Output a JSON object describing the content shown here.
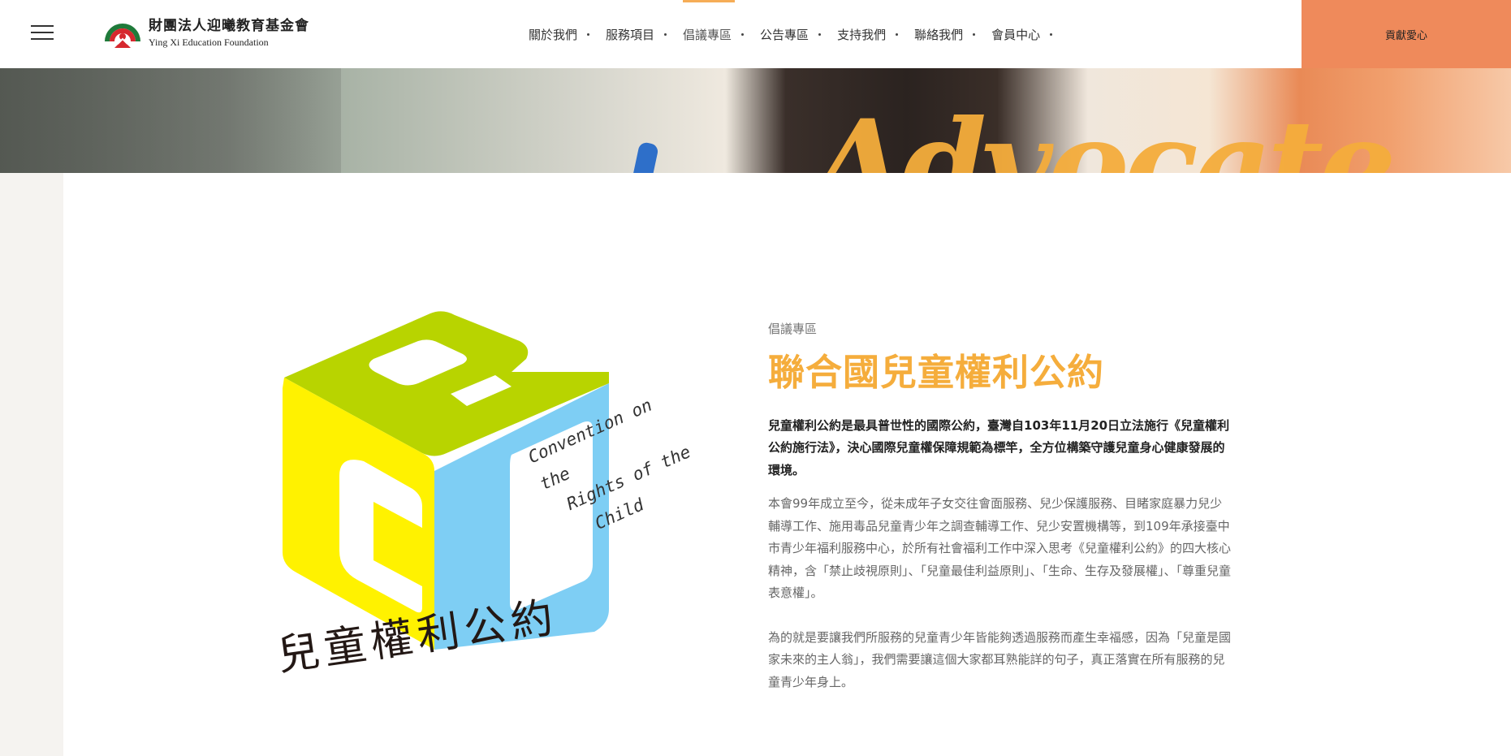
{
  "header": {
    "logo": {
      "name_cn": "財團法人迎曦教育基金會",
      "name_en": "Ying Xi Education Foundation"
    },
    "nav": [
      {
        "label": "關於我們"
      },
      {
        "label": "服務項目"
      },
      {
        "label": "倡議專區",
        "active": true
      },
      {
        "label": "公告專區"
      },
      {
        "label": "支持我們"
      },
      {
        "label": "聯絡我們"
      },
      {
        "label": "會員中心"
      }
    ],
    "donate_label": "貢獻愛心",
    "colors": {
      "accent": "#f6ad57",
      "donate_bg": "#ef8a5b"
    }
  },
  "banner": {
    "text": "Advocate"
  },
  "logo_graphic": {
    "english": [
      "Convention on the",
      "Rights of the",
      "Child"
    ],
    "chinese": "兒童權利公約",
    "colors": {
      "top": "#b8d400",
      "left": "#fff200",
      "right": "#7ecef4"
    }
  },
  "content": {
    "breadcrumb": "倡議專區",
    "title": "聯合國兒童權利公約",
    "lead": "兒童權利公約是最具普世性的國際公約，臺灣自103年11月20日立法施行《兒童權利公約施行法》，決心國際兒童權保障規範為標竿，全方位構築守護兒童身心健康發展的環境。",
    "para1": "本會99年成立至今，從未成年子女交往會面服務、兒少保護服務、目睹家庭暴力兒少輔導工作、施用毒品兒童青少年之調查輔導工作、兒少安置機構等，到109年承接臺中市青少年福利服務中心，於所有社會福利工作中深入思考《兒童權利公約》的四大核心精神，含「禁止歧視原則」、「兒童最佳利益原則」、「生命、生存及發展權」、「尊重兒童表意權」。",
    "para2": "為的就是要讓我們所服務的兒童青少年皆能夠透過服務而產生幸福感，因為「兒童是國家未來的主人翁」，我們需要讓這個大家都耳熟能詳的句子，真正落實在所有服務的兒童青少年身上。",
    "title_color": "#f5ad3c"
  }
}
